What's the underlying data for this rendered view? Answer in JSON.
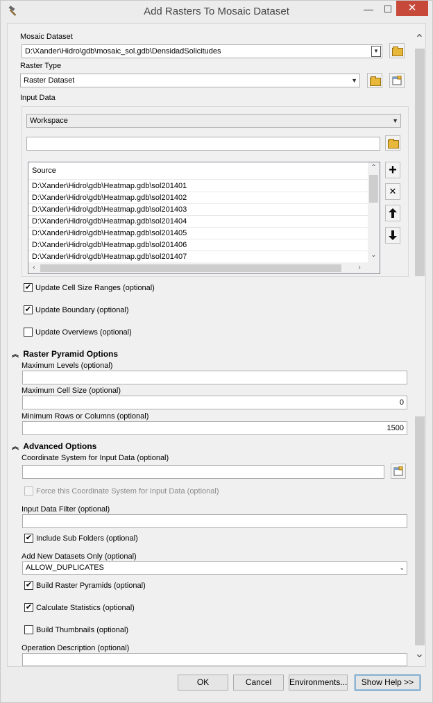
{
  "window": {
    "title": "Add Rasters To Mosaic Dataset",
    "minimize": "—",
    "maximize": "☐",
    "close": "✕"
  },
  "mosaic_dataset": {
    "label": "Mosaic Dataset",
    "value": "D:\\Xander\\Hidro\\gdb\\mosaic_sol.gdb\\DensidadSolicitudes"
  },
  "raster_type": {
    "label": "Raster Type",
    "value": "Raster Dataset"
  },
  "input_data": {
    "label": "Input Data",
    "mode": "Workspace",
    "path": "",
    "list_header": "Source",
    "rows": [
      "D:\\Xander\\Hidro\\gdb\\Heatmap.gdb\\sol201401",
      "D:\\Xander\\Hidro\\gdb\\Heatmap.gdb\\sol201402",
      "D:\\Xander\\Hidro\\gdb\\Heatmap.gdb\\sol201403",
      "D:\\Xander\\Hidro\\gdb\\Heatmap.gdb\\sol201404",
      "D:\\Xander\\Hidro\\gdb\\Heatmap.gdb\\sol201405",
      "D:\\Xander\\Hidro\\gdb\\Heatmap.gdb\\sol201406",
      "D:\\Xander\\Hidro\\gdb\\Heatmap.gdb\\sol201407"
    ]
  },
  "options": {
    "update_cell_size": {
      "label": "Update Cell Size Ranges (optional)",
      "checked": true
    },
    "update_boundary": {
      "label": "Update Boundary (optional)",
      "checked": true
    },
    "update_overviews": {
      "label": "Update Overviews (optional)",
      "checked": false
    }
  },
  "pyramid": {
    "title": "Raster Pyramid Options",
    "max_levels_label": "Maximum Levels (optional)",
    "max_levels_value": "",
    "max_cell_label": "Maximum Cell Size (optional)",
    "max_cell_value": "0",
    "min_rows_label": "Minimum Rows or Columns (optional)",
    "min_rows_value": "1500"
  },
  "advanced": {
    "title": "Advanced Options",
    "coord_label": "Coordinate System for Input Data (optional)",
    "coord_value": "",
    "force_coord_label": "Force this Coordinate System for Input Data (optional)",
    "input_filter_label": "Input Data Filter (optional)",
    "input_filter_value": "",
    "include_sub_folders": {
      "label": "Include Sub Folders (optional)",
      "checked": true
    },
    "add_new_label": "Add New Datasets Only (optional)",
    "add_new_value": "ALLOW_DUPLICATES",
    "build_pyramids": {
      "label": "Build Raster Pyramids (optional)",
      "checked": true
    },
    "calc_stats": {
      "label": "Calculate Statistics (optional)",
      "checked": true
    },
    "build_thumbnails": {
      "label": "Build Thumbnails (optional)",
      "checked": false
    },
    "op_desc_label": "Operation Description (optional)",
    "op_desc_value": ""
  },
  "buttons": {
    "ok": "OK",
    "cancel": "Cancel",
    "environments": "Environments...",
    "show_help": "Show Help >>"
  },
  "icons": {
    "check": "✔",
    "collapse": "⌃",
    "add": "+",
    "remove": "✕",
    "up": "🡅",
    "down": "🡇"
  }
}
